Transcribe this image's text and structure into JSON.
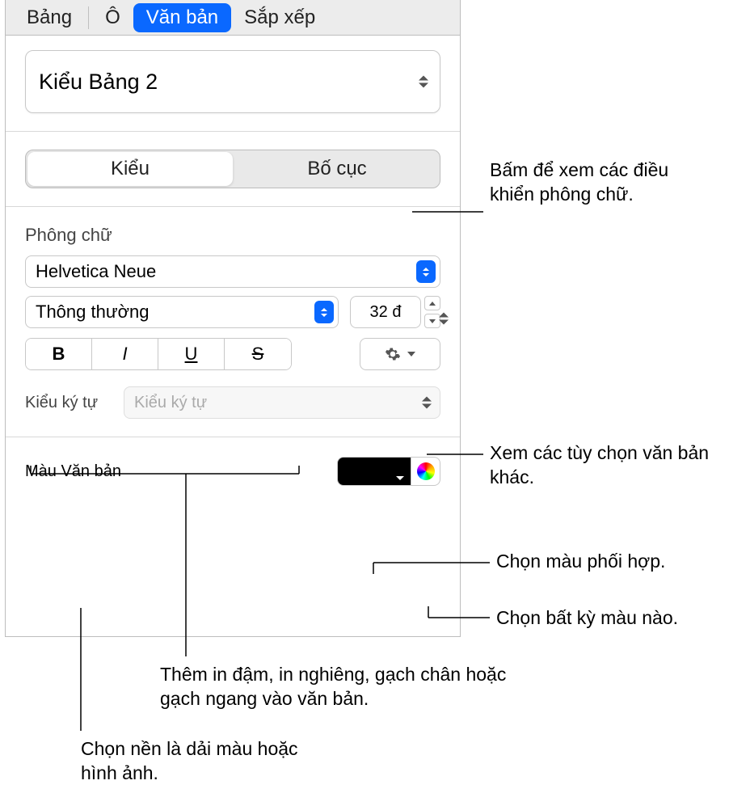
{
  "tabs": {
    "table": "Bảng",
    "cell": "Ô",
    "text": "Văn bản",
    "arrange": "Sắp xếp"
  },
  "styleSelect": {
    "value": "Kiểu Bảng 2"
  },
  "segment": {
    "style": "Kiểu",
    "layout": "Bố cục"
  },
  "font": {
    "label": "Phông chữ",
    "family": "Helvetica Neue",
    "weight": "Thông thường",
    "size": "32 đ",
    "b": "B",
    "i": "I",
    "u": "U",
    "s": "S"
  },
  "charStyle": {
    "label": "Kiểu ký tự",
    "placeholder": "Kiểu ký tự"
  },
  "textColor": {
    "label": "Màu Văn bản"
  },
  "callouts": {
    "fontControls": "Bấm để xem các điều khiển phông chữ.",
    "moreOptions": "Xem các tùy chọn văn bản khác.",
    "matchColor": "Chọn màu phối hợp.",
    "anyColor": "Chọn bất kỳ màu nào.",
    "styleButtons": "Thêm in đậm, in nghiêng, gạch chân hoặc gạch ngang vào văn bản.",
    "textColorBg": "Chọn nền là dải màu hoặc hình ảnh."
  }
}
